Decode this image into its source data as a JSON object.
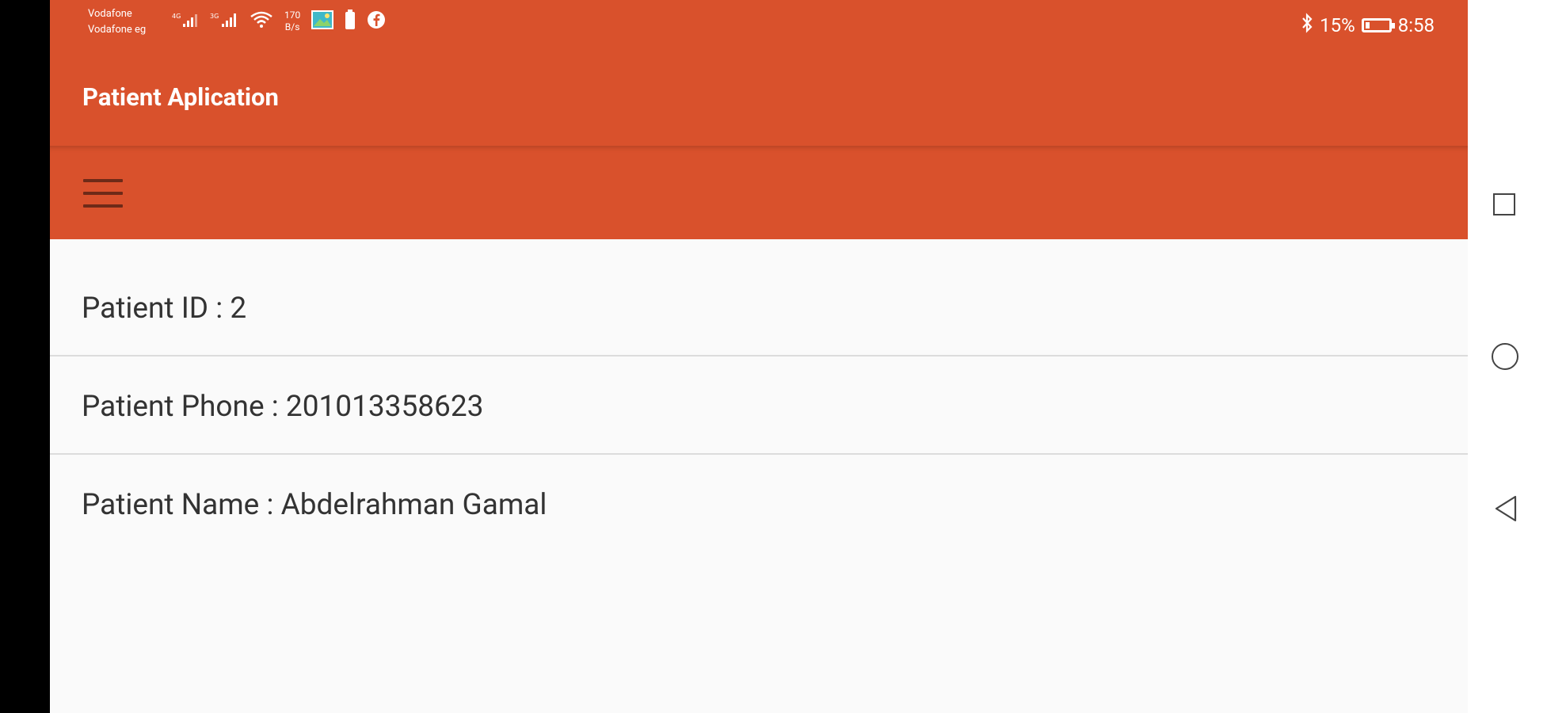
{
  "status_bar": {
    "carrier_1": "Vodafone",
    "carrier_2": "Vodafone eg",
    "network_1": "4G",
    "network_2": "3G",
    "speed_value": "170",
    "speed_unit": "B/s",
    "battery_percent": "15%",
    "time": "8:58"
  },
  "app_bar": {
    "title": "Patient Aplication"
  },
  "patient_info": {
    "rows": [
      {
        "text": "Patient ID : 2"
      },
      {
        "text": "Patient Phone : 201013358623"
      },
      {
        "text": "Patient Name : Abdelrahman Gamal"
      }
    ]
  },
  "navigation_bar": {
    "items": [
      "recent-apps",
      "home",
      "back"
    ]
  },
  "colors": {
    "primary": "#d9512c",
    "background": "#fafafa",
    "text": "#333333"
  }
}
